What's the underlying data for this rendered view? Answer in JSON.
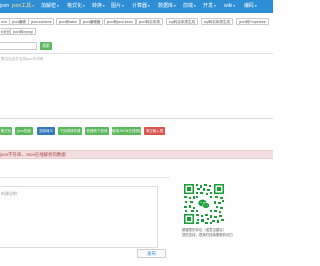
{
  "nav": {
    "items": [
      {
        "label": "json"
      },
      {
        "label": "json工具",
        "dropdown": true,
        "active": true
      },
      {
        "label": "加解密",
        "dropdown": true
      },
      {
        "label": "格式化",
        "dropdown": true
      },
      {
        "label": "转换",
        "dropdown": true
      },
      {
        "label": "图片",
        "dropdown": true
      },
      {
        "label": "计算器",
        "dropdown": true
      },
      {
        "label": "数据库",
        "dropdown": true
      },
      {
        "label": "前端",
        "dropdown": true
      },
      {
        "label": "开发",
        "dropdown": true
      },
      {
        "label": "wiki",
        "dropdown": true
      },
      {
        "label": "编码",
        "dropdown": true
      }
    ]
  },
  "subnav": {
    "row1": [
      "son",
      "json编辑",
      "json-schema",
      "json转table",
      "json编辑器",
      "json转java bean",
      "json转实体类",
      "sql转实体类生成",
      "sql转实体类生成",
      "json转Properties"
    ],
    "row2": [
      "h对比",
      "json转mysql"
    ]
  },
  "search": {
    "button_label": "搜索"
  },
  "editor": {
    "placeholder": "是否包含并支持json字符串"
  },
  "actions": {
    "buttons": [
      {
        "label": "格式化",
        "color": "green"
      },
      {
        "label": "json压缩",
        "color": "green"
      },
      {
        "label": "去除转义",
        "color": "blue"
      },
      {
        "label": "下划线转驼峰",
        "color": "green"
      },
      {
        "label": "驼峰转下划线",
        "color": "green"
      },
      {
        "label": "使用JSON在线测试",
        "color": "green"
      },
      {
        "label": "清空输入框",
        "color": "red"
      }
    ],
    "colors": {
      "green": "#5cb85c",
      "blue": "#337ab7",
      "red": "#d9534f"
    }
  },
  "tip": {
    "text": "json字符串，Json在线解析的数据"
  },
  "comment": {
    "placeholder": "的建议吧~",
    "publish_label": "发布"
  },
  "qr": {
    "icon": "wechat-qr-code",
    "caption_line1": "期望您的评论（或意见建议）",
    "caption_line2": "您的支持，是我们持续更新的动力"
  }
}
